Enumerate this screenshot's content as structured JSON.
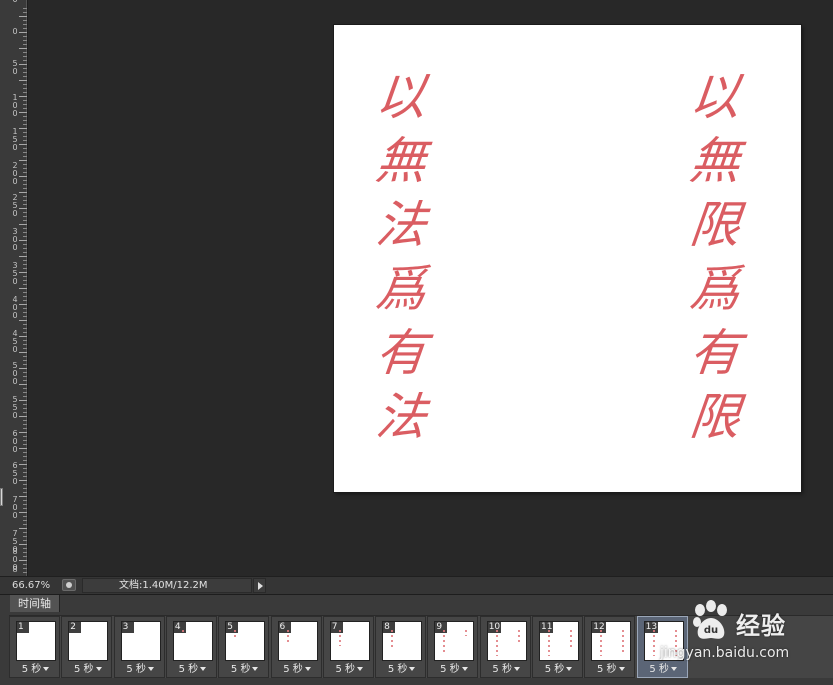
{
  "ruler": {
    "labels": [
      "0",
      "0",
      "5\n0",
      "1\n0\n0",
      "1\n5\n0",
      "2\n0\n0",
      "2\n5\n0",
      "3\n0\n0",
      "3\n5\n0",
      "4\n0\n0",
      "4\n5\n0",
      "5\n0\n0",
      "5\n5\n0",
      "6\n0\n0",
      "6\n5\n0",
      "7\n0\n0",
      "7\n5\n0",
      "8\n0\n0",
      "8"
    ]
  },
  "document": {
    "left_column": [
      "以",
      "無",
      "法",
      "爲",
      "有",
      "法"
    ],
    "right_column": [
      "以",
      "無",
      "限",
      "爲",
      "有",
      "限"
    ],
    "ink_color": "#d9555a"
  },
  "status_bar": {
    "zoom": "66.67%",
    "doc_info": "文档:1.40M/12.2M"
  },
  "timeline": {
    "tab_label": "时间轴",
    "frames": [
      {
        "num": "1",
        "delay": "5 秒"
      },
      {
        "num": "2",
        "delay": "5 秒"
      },
      {
        "num": "3",
        "delay": "5 秒"
      },
      {
        "num": "4",
        "delay": "5 秒"
      },
      {
        "num": "5",
        "delay": "5 秒"
      },
      {
        "num": "6",
        "delay": "5 秒"
      },
      {
        "num": "7",
        "delay": "5 秒"
      },
      {
        "num": "8",
        "delay": "5 秒"
      },
      {
        "num": "9",
        "delay": "5 秒"
      },
      {
        "num": "10",
        "delay": "5 秒"
      },
      {
        "num": "11",
        "delay": "5 秒"
      },
      {
        "num": "12",
        "delay": "5 秒"
      },
      {
        "num": "13",
        "delay": "5 秒"
      }
    ],
    "selected_frame": "13"
  },
  "watermark": {
    "brand": "经验",
    "url": "jingyan.baidu.com"
  }
}
